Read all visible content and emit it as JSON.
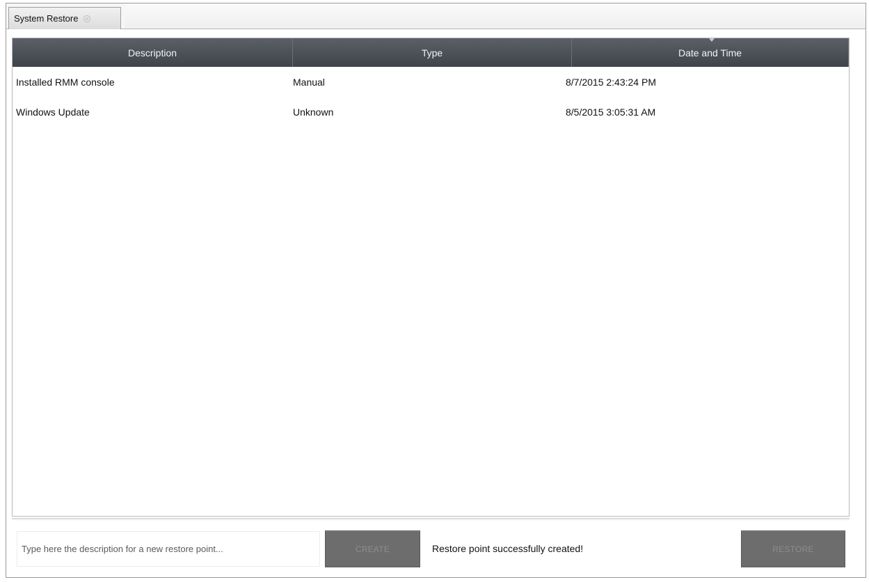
{
  "tab": {
    "title": "System Restore"
  },
  "table": {
    "columns": [
      "Description",
      "Type",
      "Date and Time"
    ],
    "rows": [
      {
        "description": "Installed RMM console",
        "type": "Manual",
        "datetime": "8/7/2015 2:43:24 PM"
      },
      {
        "description": "Windows Update",
        "type": "Unknown",
        "datetime": "8/5/2015 3:05:31 AM"
      }
    ],
    "sorted_column": "Date and Time"
  },
  "footer": {
    "description_placeholder": "Type here the description for a new restore point...",
    "description_value": "",
    "create_label": "CREATE",
    "status_message": "Restore point successfully created!",
    "restore_label": "RESTORE"
  },
  "colors": {
    "header_bg": "#4a4f56",
    "button_disabled_bg": "#6d6d6d",
    "button_disabled_text": "#8d8d8d"
  }
}
